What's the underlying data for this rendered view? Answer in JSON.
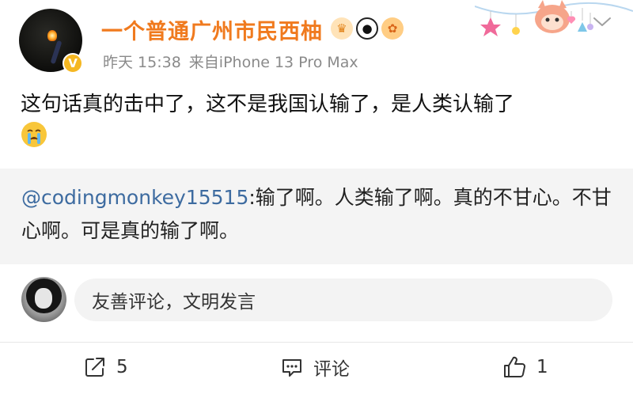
{
  "post": {
    "author": {
      "name": "一个普通广州市民西柚",
      "verified_badge": "V",
      "name_color": "#f07a1e"
    },
    "badges": [
      "crown-icon",
      "panda-icon",
      "pufferfish-icon"
    ],
    "time": "昨天 15:38",
    "source": "来自iPhone 13 Pro Max",
    "text": "这句话真的击中了，这不是我国认输了，是人类认输了",
    "trailing_emoji": "crying-face-emoji"
  },
  "quote": {
    "mention": "@codingmonkey15515",
    "text": ":输了啊。人类输了啊。真的不甘心。不甘心啊。可是真的输了啊。"
  },
  "comment_input": {
    "placeholder": "友善评论，文明发言"
  },
  "actions": {
    "share_count": "5",
    "comment_label": "评论",
    "like_count": "1"
  },
  "colors": {
    "mention": "#3d6ba0",
    "quote_background": "#f4f4f4",
    "meta_text": "#8a8a8a"
  }
}
